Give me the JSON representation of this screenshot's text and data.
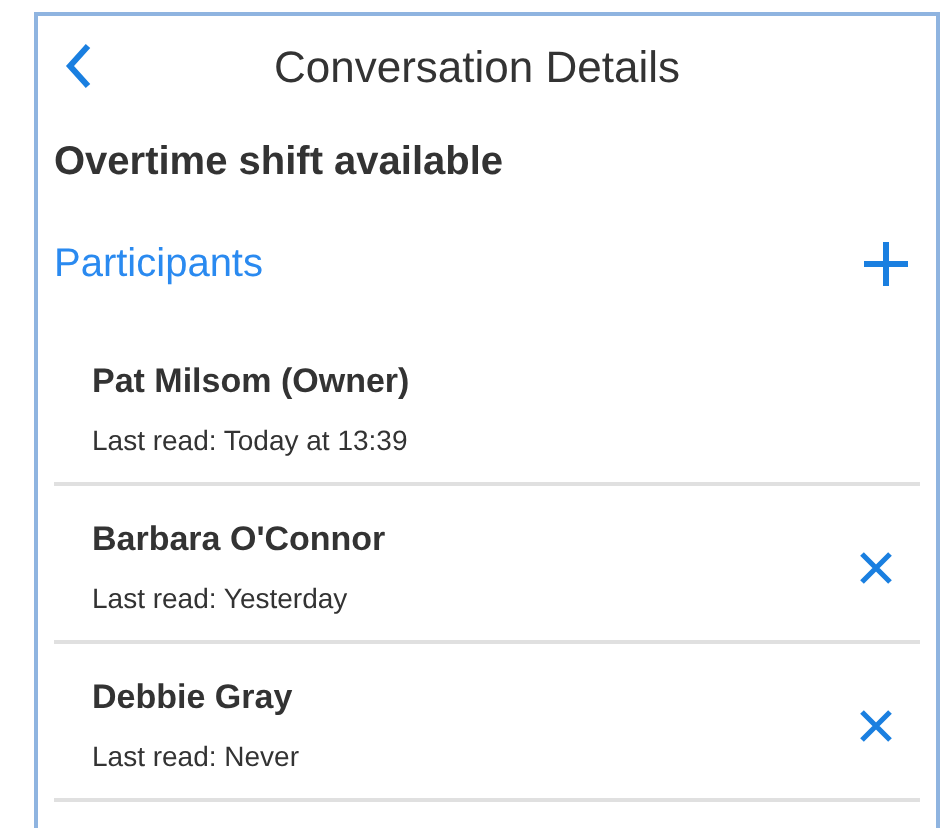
{
  "header": {
    "title": "Conversation Details"
  },
  "conversation": {
    "subject": "Overtime shift available"
  },
  "participants_section": {
    "title": "Participants"
  },
  "participants": [
    {
      "name": "Pat Milsom (Owner)",
      "last_read": "Last read: Today at 13:39",
      "removable": false
    },
    {
      "name": "Barbara O'Connor",
      "last_read": "Last read: Yesterday",
      "removable": true
    },
    {
      "name": "Debbie Gray",
      "last_read": "Last read: Never",
      "removable": true
    }
  ]
}
